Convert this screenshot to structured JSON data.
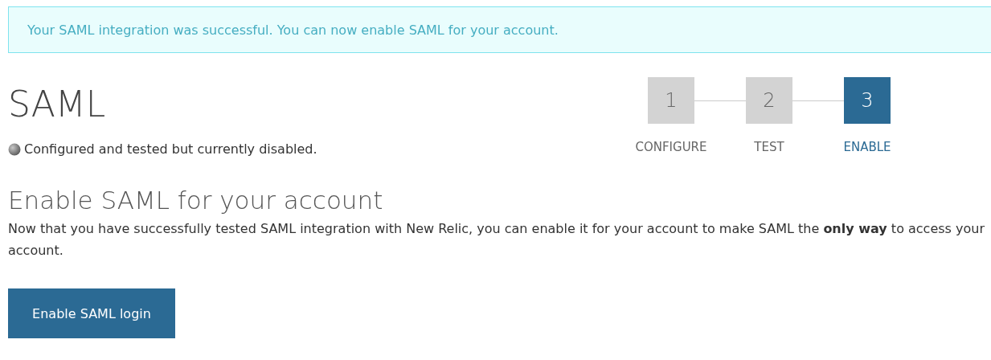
{
  "banner": {
    "text": "Your SAML integration was successful. You can now enable SAML for your account."
  },
  "title": "SAML",
  "status": {
    "text": "Configured and tested but currently disabled."
  },
  "steps": [
    {
      "number": "1",
      "label": "CONFIGURE",
      "selected": false
    },
    {
      "number": "2",
      "label": "TEST",
      "selected": false
    },
    {
      "number": "3",
      "label": "ENABLE",
      "selected": true
    }
  ],
  "section": {
    "heading": "Enable SAML for your account",
    "description": "Now that you have successfully tested SAML integration with New Relic, you can enable it for your account to make SAML the **only way** to access your account.",
    "button": "Enable SAML login"
  }
}
